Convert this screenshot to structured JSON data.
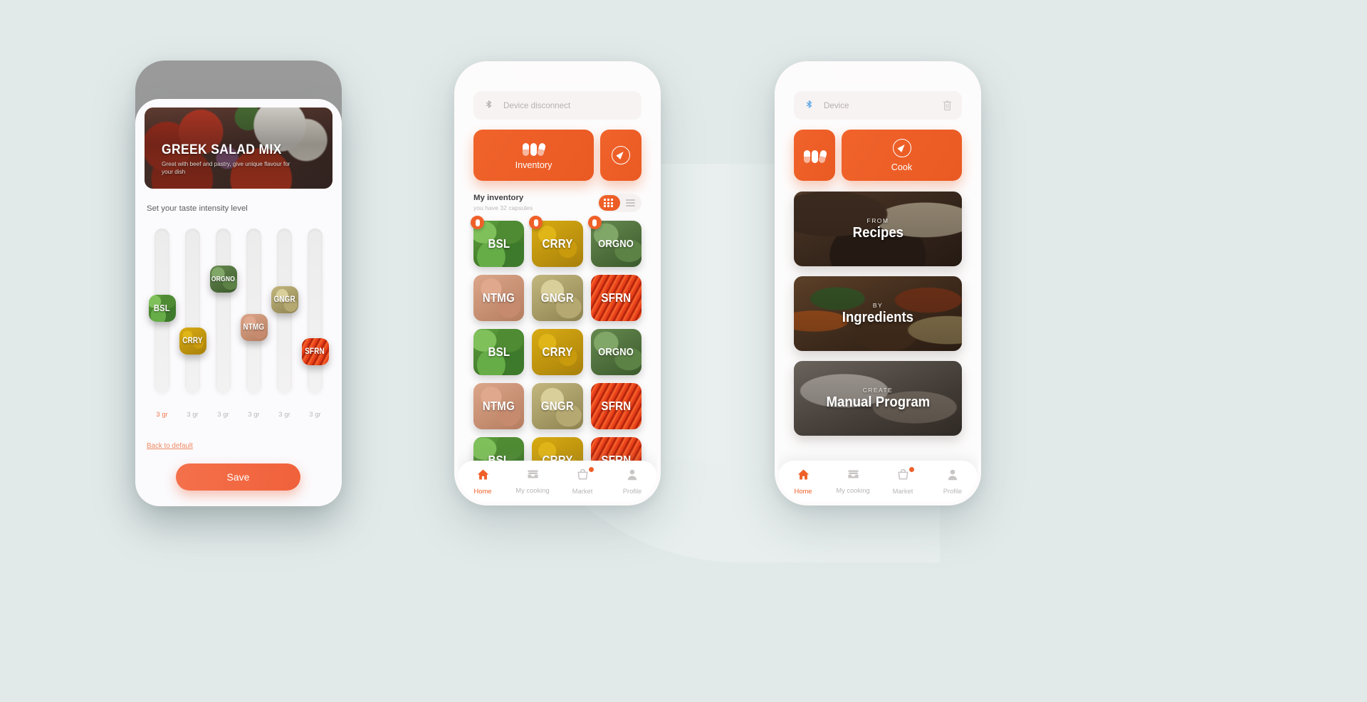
{
  "background_color": "#e2e9e9",
  "accent_color": "#ef6029",
  "phone1": {
    "hero": {
      "title": "GREEK SALAD MIX",
      "subtitle": "Great with beef and pastry, give unique flavour for your dish"
    },
    "section_label": "Set your taste intensity level",
    "sliders": [
      {
        "code": "BSL",
        "value_label": "3 gr",
        "active": true,
        "level": 52
      },
      {
        "code": "CRRY",
        "value_label": "3 gr",
        "active": false,
        "level": 28
      },
      {
        "code": "ORGNO",
        "value_label": "3 gr",
        "active": false,
        "level": 73
      },
      {
        "code": "NTMG",
        "value_label": "3 gr",
        "active": false,
        "level": 38
      },
      {
        "code": "GNGR",
        "value_label": "3 gr",
        "active": false,
        "level": 58
      },
      {
        "code": "SFRN",
        "value_label": "3 gr",
        "active": false,
        "level": 20
      }
    ],
    "reset_link": "Back to default",
    "save_button": "Save"
  },
  "phone2": {
    "device_bar": {
      "status": "Device disconnect",
      "bluetooth_icon": "bluetooth-icon",
      "connected": false
    },
    "primary_action": {
      "label": "Inventory",
      "icon": "capsules-icon"
    },
    "secondary_action": {
      "icon": "compass-icon"
    },
    "inventory": {
      "title": "My inventory",
      "subtitle": "you have 32 capsules",
      "view_mode": "grid",
      "grid_icon": "grid-view-icon",
      "list_icon": "list-view-icon",
      "capsules": [
        {
          "code": "BSL",
          "texture": "tex-bsl",
          "badge": true
        },
        {
          "code": "CRRY",
          "texture": "tex-crry",
          "badge": true
        },
        {
          "code": "ORGNO",
          "texture": "tex-orgno",
          "badge": true
        },
        {
          "code": "NTMG",
          "texture": "tex-ntmg",
          "badge": false
        },
        {
          "code": "GNGR",
          "texture": "tex-gngr",
          "badge": false
        },
        {
          "code": "SFRN",
          "texture": "tex-sfrn",
          "badge": false
        },
        {
          "code": "BSL",
          "texture": "tex-bsl",
          "badge": false
        },
        {
          "code": "CRRY",
          "texture": "tex-crry",
          "badge": false
        },
        {
          "code": "ORGNO",
          "texture": "tex-orgno",
          "badge": false
        },
        {
          "code": "NTMG",
          "texture": "tex-ntmg",
          "badge": false
        },
        {
          "code": "GNGR",
          "texture": "tex-gngr",
          "badge": false
        },
        {
          "code": "SFRN",
          "texture": "tex-sfrn",
          "badge": false
        },
        {
          "code": "BSL",
          "texture": "tex-bsl",
          "badge": false
        },
        {
          "code": "CRRY",
          "texture": "tex-crry",
          "badge": false
        },
        {
          "code": "SFRN",
          "texture": "tex-sfrn",
          "badge": false
        }
      ]
    },
    "tabs": [
      {
        "label": "Home",
        "icon": "home-icon",
        "active": true,
        "dot": false
      },
      {
        "label": "My cooking",
        "icon": "cooking-icon",
        "active": false,
        "dot": false
      },
      {
        "label": "Market",
        "icon": "market-icon",
        "active": false,
        "dot": true
      },
      {
        "label": "Profile",
        "icon": "profile-icon",
        "active": false,
        "dot": false
      }
    ]
  },
  "phone3": {
    "device_bar": {
      "status": "Device",
      "bluetooth_icon": "bluetooth-icon",
      "connected": true,
      "trash_icon": "trash-icon"
    },
    "secondary_action": {
      "icon": "capsules-icon"
    },
    "primary_action": {
      "label": "Cook",
      "icon": "compass-icon"
    },
    "cards": [
      {
        "kicker": "FROM",
        "title": "Recipes",
        "texture": "bg-recipes"
      },
      {
        "kicker": "BY",
        "title": "Ingredients",
        "texture": "bg-ingr"
      },
      {
        "kicker": "CREATE",
        "title": "Manual Program",
        "texture": "bg-manual"
      }
    ],
    "tabs": [
      {
        "label": "Home",
        "icon": "home-icon",
        "active": true,
        "dot": false
      },
      {
        "label": "My cooking",
        "icon": "cooking-icon",
        "active": false,
        "dot": false
      },
      {
        "label": "Market",
        "icon": "market-icon",
        "active": false,
        "dot": true
      },
      {
        "label": "Profile",
        "icon": "profile-icon",
        "active": false,
        "dot": false
      }
    ]
  }
}
